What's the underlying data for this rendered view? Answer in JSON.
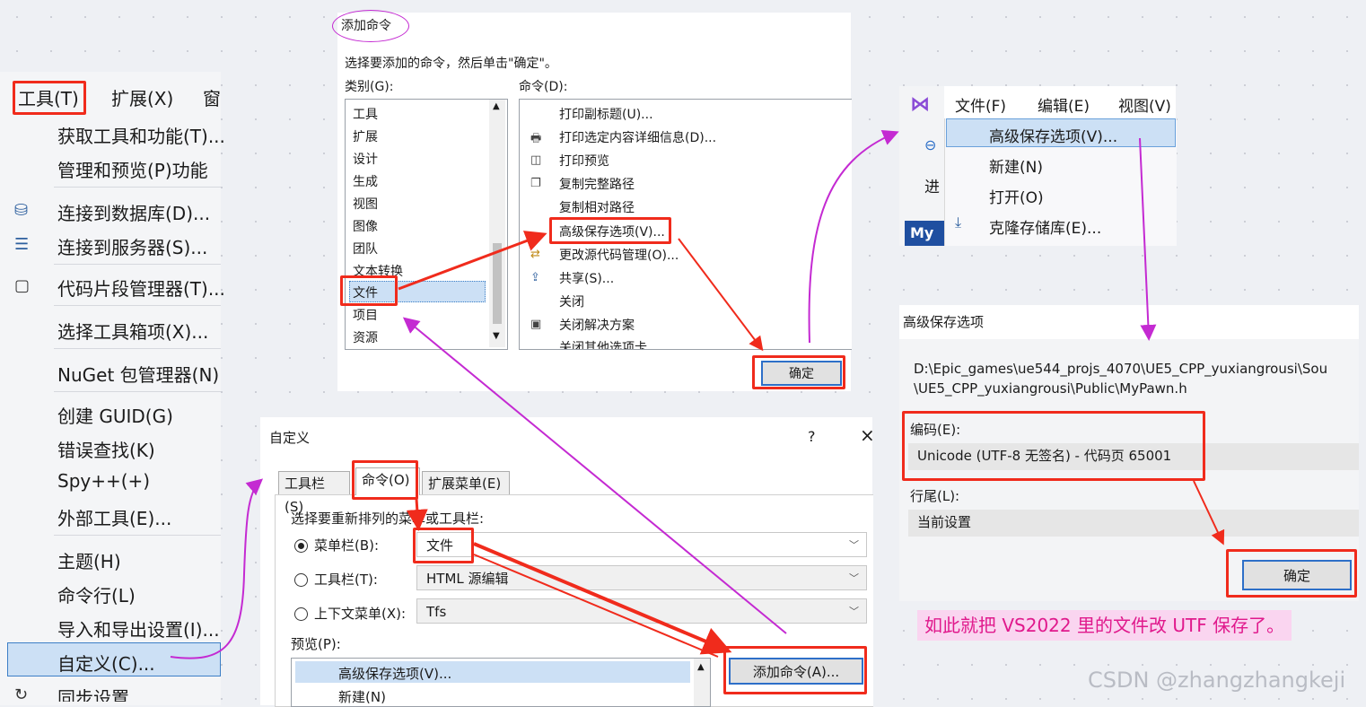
{
  "tools_menu": {
    "menubar": [
      "工具(T)",
      "扩展(X)",
      "窗"
    ],
    "items": [
      "获取工具和功能(T)...",
      "管理和预览(P)功能",
      "连接到数据库(D)...",
      "连接到服务器(S)...",
      "代码片段管理器(T)...",
      "选择工具箱项(X)...",
      "NuGet 包管理器(N)",
      "创建 GUID(G)",
      "错误查找(K)",
      "Spy++(+)",
      "外部工具(E)...",
      "主题(H)",
      "命令行(L)",
      "导入和导出设置(I)...",
      "自定义(C)...",
      "同步设置"
    ]
  },
  "add_command": {
    "title": "添加命令",
    "instruction": "选择要添加的命令，然后单击\"确定\"。",
    "category_label": "类别(G):",
    "command_label": "命令(D):",
    "categories": [
      "工具",
      "扩展",
      "设计",
      "生成",
      "视图",
      "图像",
      "团队",
      "文本转换",
      "文件",
      "项目",
      "资源"
    ],
    "commands": [
      "打印副标题(U)...",
      "打印选定内容详细信息(D)...",
      "打印预览",
      "复制完整路径",
      "复制相对路径",
      "高级保存选项(V)...",
      "更改源代码管理(O)...",
      "共享(S)...",
      "关闭",
      "关闭解决方案",
      "关闭其他选项卡"
    ],
    "ok": "确定"
  },
  "customize": {
    "title": "自定义",
    "help": "?",
    "close": "×",
    "tabs": [
      "工具栏(S)",
      "命令(O)",
      "扩展菜单(E)"
    ],
    "section_label": "选择要重新排列的菜单或工具栏:",
    "options": [
      {
        "label": "菜单栏(B):",
        "value": "文件"
      },
      {
        "label": "工具栏(T):",
        "value": "HTML 源编辑"
      },
      {
        "label": "上下文菜单(X):",
        "value": "Tfs"
      }
    ],
    "preview_label": "预览(P):",
    "preview_items": [
      "高级保存选项(V)...",
      "新建(N)"
    ],
    "add_button": "添加命令(A)..."
  },
  "file_menu": {
    "menubar": [
      "文件(F)",
      "编辑(E)",
      "视图(V)"
    ],
    "items": [
      "高级保存选项(V)...",
      "新建(N)",
      "打开(O)",
      "克隆存储库(E)..."
    ],
    "side_text": [
      "进",
      "My"
    ]
  },
  "advanced_save": {
    "title": "高级保存选项",
    "path": [
      "D:\\Epic_games\\ue544_projs_4070\\UE5_CPP_yuxiangrousi\\Sou",
      "\\UE5_CPP_yuxiangrousi\\Public\\MyPawn.h"
    ],
    "encoding_label": "编码(E):",
    "encoding_value": "Unicode (UTF-8 无签名) - 代码页 65001",
    "line_ending_label": "行尾(L):",
    "line_ending_value": "当前设置",
    "ok": "确定"
  },
  "note": "如此就把 VS2022 里的文件改 UTF 保存了。",
  "watermark": "CSDN @zhangzhangkeji",
  "colors": {
    "annotation_red": "#f02b1c",
    "arrow_magenta": "#c42ad2",
    "selection": "#cce0f5",
    "note_bg": "#fad5f0",
    "note_text": "#e0198c"
  }
}
